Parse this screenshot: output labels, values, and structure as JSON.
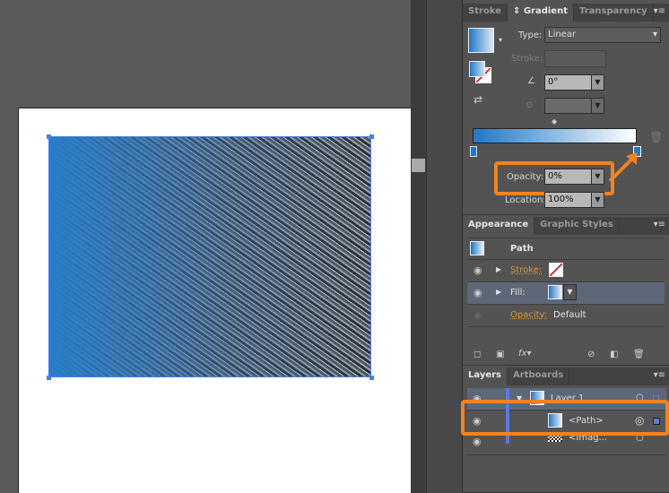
{
  "gradient_panel": {
    "tabs": [
      "Stroke",
      "Gradient",
      "Transparency"
    ],
    "active_tab": "Gradient",
    "type_label": "Type:",
    "type_value": "Linear",
    "stroke_label": "Stroke:",
    "angle_value": "0°",
    "aspect_value": "",
    "opacity_label": "Opacity:",
    "opacity_value": "0%",
    "location_label": "Location:",
    "location_value": "100%",
    "gradient_colors": [
      "#1f78c8",
      "#ffffff"
    ],
    "highlight_color": "#f58220"
  },
  "appearance_panel": {
    "tabs": [
      "Appearance",
      "Graphic Styles"
    ],
    "title": "Path",
    "stroke_label": "Stroke:",
    "fill_label": "Fill:",
    "opacity_label": "Opacity:",
    "opacity_value": "Default",
    "fx_label": "fx"
  },
  "layers_panel": {
    "tabs": [
      "Layers",
      "Artboards"
    ],
    "items": [
      {
        "name": "Layer 1"
      },
      {
        "name": "<Path>"
      },
      {
        "name": "<Imag..."
      }
    ]
  }
}
